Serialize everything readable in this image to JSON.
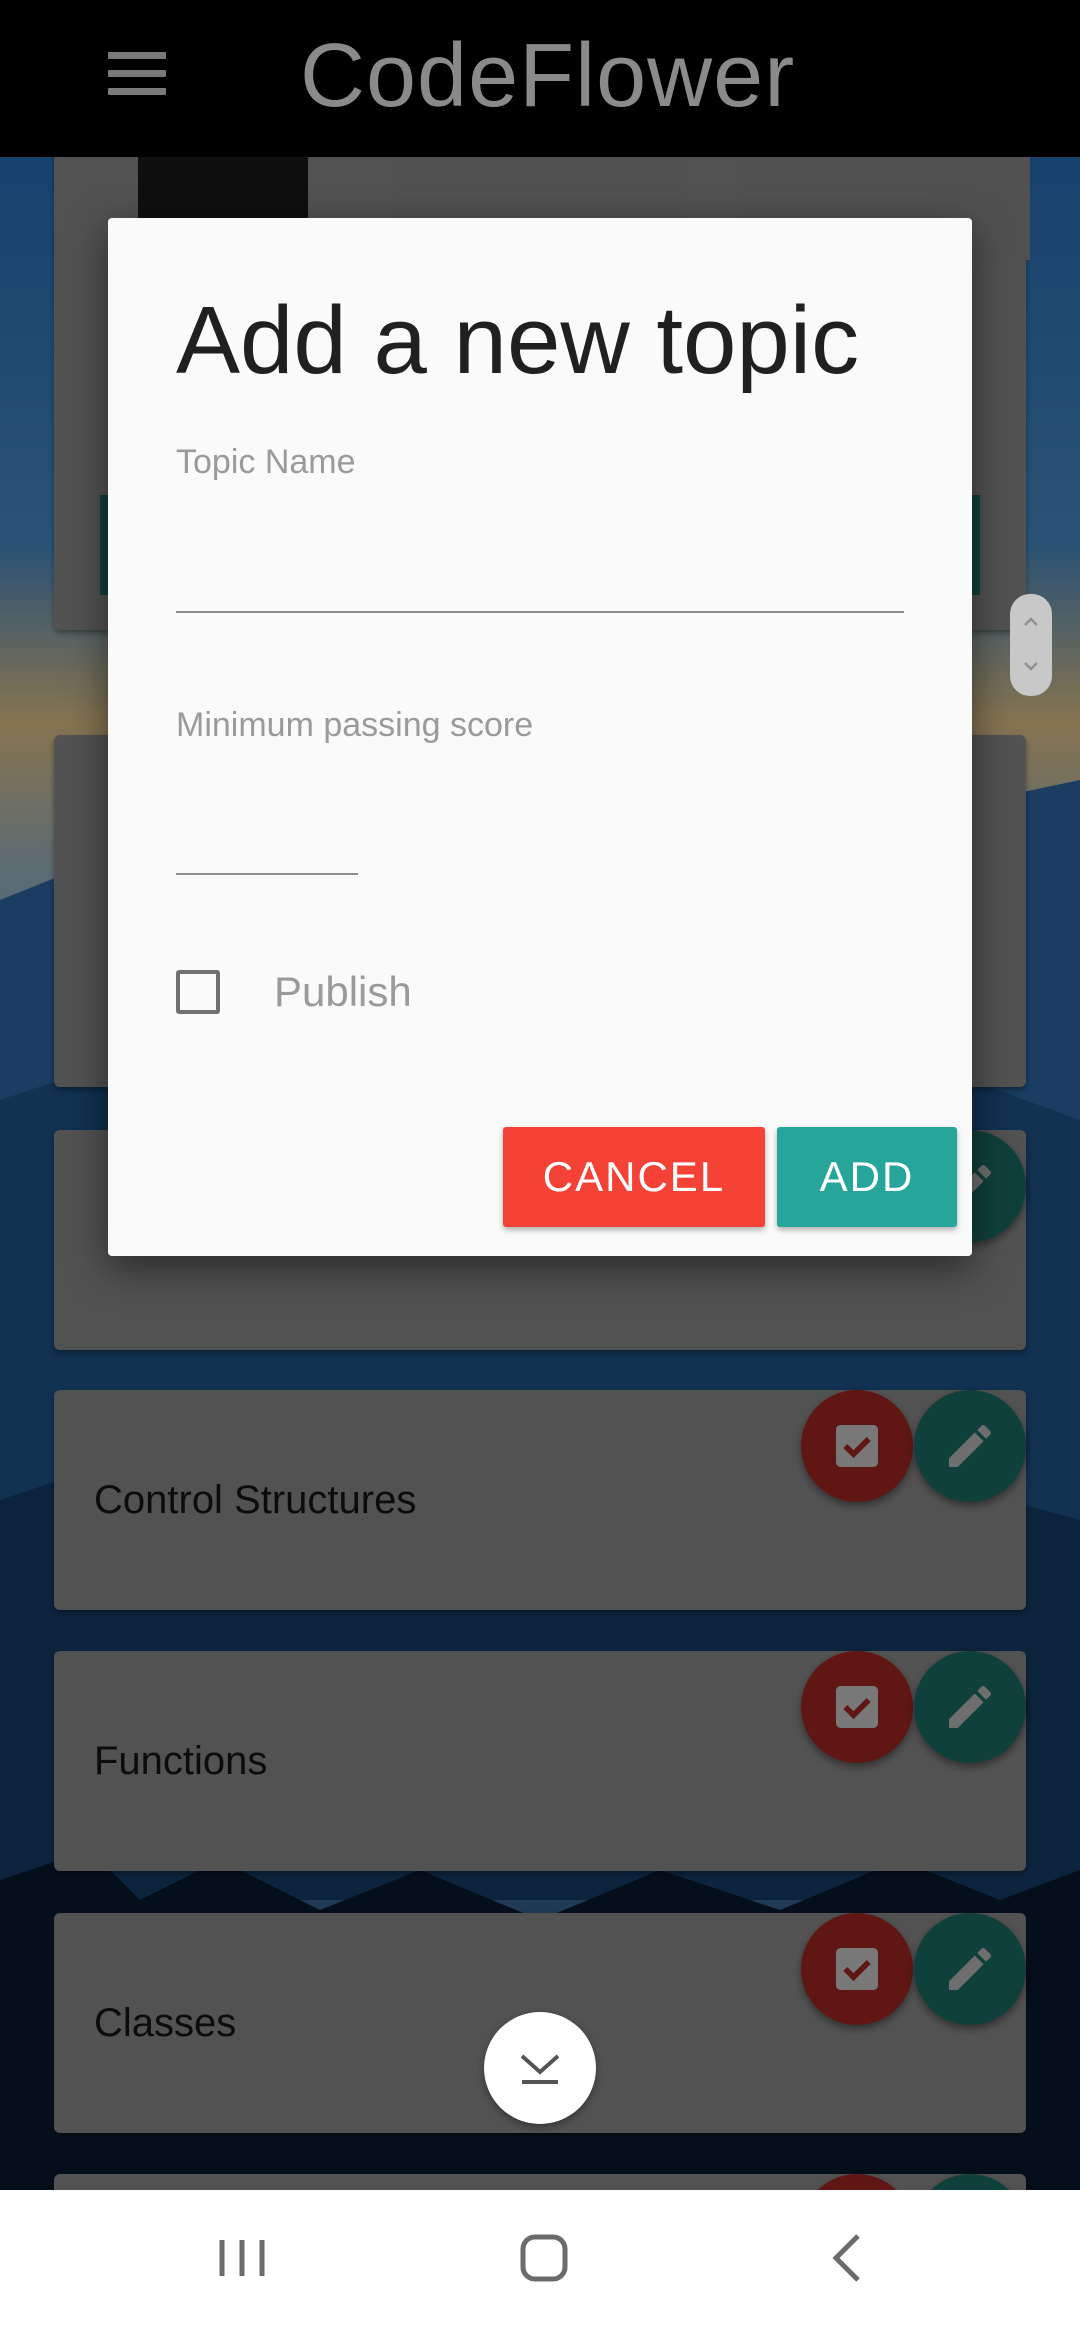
{
  "app": {
    "title": "CodeFlower"
  },
  "topics": [
    {
      "label": "Control Structures"
    },
    {
      "label": "Functions"
    },
    {
      "label": "Classes"
    }
  ],
  "dialog": {
    "title": "Add a new topic",
    "topic_name_label": "Topic Name",
    "topic_name_value": "",
    "min_score_label": "Minimum passing score",
    "min_score_value": "",
    "publish_label": "Publish",
    "publish_checked": false,
    "cancel_label": "CANCEL",
    "add_label": "ADD"
  },
  "colors": {
    "cancel": "#f44336",
    "add": "#26a69a",
    "fab_red": "#a52824",
    "fab_green": "#1d6e66"
  },
  "icons": {
    "menu": "hamburger-icon",
    "check": "checkbox-check-icon",
    "edit": "pencil-icon",
    "scroll_bottom": "download-arrow-icon",
    "nav_recents": "recents-icon",
    "nav_home": "home-icon",
    "nav_back": "back-icon"
  }
}
